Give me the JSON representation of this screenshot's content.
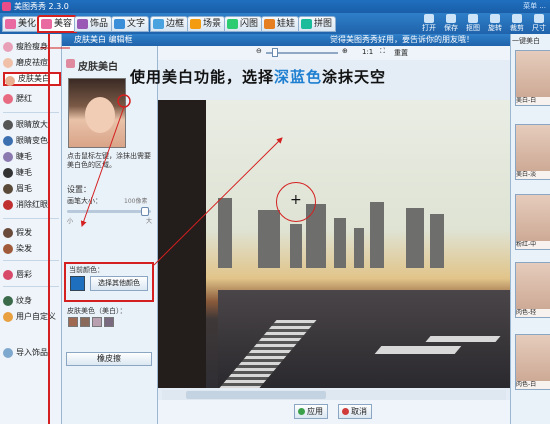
{
  "app": {
    "title": "美图秀秀 2.3.0",
    "right_text": "菜单 ..."
  },
  "tabs": [
    {
      "label": "美化",
      "color": "#e86aa0"
    },
    {
      "label": "美容",
      "color": "#e86aa0"
    },
    {
      "label": "饰品",
      "color": "#9b59b6"
    },
    {
      "label": "文字",
      "color": "#3b8fd9"
    },
    {
      "label": "边框",
      "color": "#4aa3df"
    },
    {
      "label": "场景",
      "color": "#f39c12"
    },
    {
      "label": "闪图",
      "color": "#2ecc71"
    },
    {
      "label": "娃娃",
      "color": "#e67e22"
    },
    {
      "label": "拼图",
      "color": "#1abc9c"
    }
  ],
  "toolbar_right": [
    "打开",
    "保存",
    "抠图",
    "旋转",
    "裁剪",
    "尺寸"
  ],
  "left_menu": [
    {
      "label": "瘦脸瘦身"
    },
    {
      "label": "磨皮祛痘"
    },
    {
      "label": "皮肤美白"
    },
    {
      "label": "腮红"
    },
    {
      "label": "眼睛放大"
    },
    {
      "label": "眼睛变色"
    },
    {
      "label": "睫毛"
    },
    {
      "label": "睫毛"
    },
    {
      "label": "眉毛"
    },
    {
      "label": "消除红眼"
    },
    {
      "label": "假发"
    },
    {
      "label": "染发"
    },
    {
      "label": "唇彩"
    },
    {
      "label": "纹身"
    },
    {
      "label": "用户自定义"
    },
    {
      "label": "导入饰品"
    }
  ],
  "subpanel": {
    "header": "皮肤美白  编辑框",
    "title": "皮肤美白",
    "hint": "点击鼠标左键，涂抹出需要美白色的区域。",
    "settings_label": "设置：",
    "brush_label": "画笔大小：",
    "brush_value": "100像素",
    "slider_min": "小",
    "slider_max": "大",
    "current_color_label": "当前颜色：",
    "pick_color_button": "选择其他颜色",
    "skin_color_label": "皮肤美色（美白）：",
    "eraser_button": "橡皮擦"
  },
  "main": {
    "banner": "觉得美图秀秀好用，要告诉你的朋友哦！",
    "zoom_label": "1:1",
    "reset_label": "重置",
    "ok_button": "应用",
    "cancel_button": "取消"
  },
  "caption": {
    "part1": "使用美白功能，选择",
    "highlight": "深蓝色",
    "part2": "涂抹天空"
  },
  "right_panel": {
    "header": "一键美白",
    "items": [
      "美白-白",
      "美白-淡",
      "粉红-中",
      "肉色-轻",
      "肉色-白"
    ]
  },
  "colors": {
    "accent": "#1f6fbf",
    "highlight": "#d42020",
    "selected_color": "#1f6fbf"
  },
  "skin_swatches": [
    "#a06a52",
    "#8a6a5a",
    "#b8a0b0",
    "#7a6a80"
  ]
}
